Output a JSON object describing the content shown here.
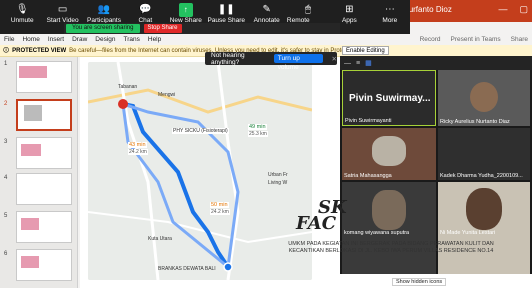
{
  "window": {
    "title": "le Kaolin Nurfanto Dioz"
  },
  "zoom_toolbar": {
    "items": [
      {
        "label": "Unmute",
        "icon": "mic-muted-icon"
      },
      {
        "label": "Start Video",
        "icon": "video-off-icon"
      },
      {
        "label": "Participants",
        "icon": "participants-icon",
        "badge": "9"
      },
      {
        "label": "Chat",
        "icon": "chat-icon"
      },
      {
        "label": "New Share",
        "icon": "share-screen-icon"
      },
      {
        "label": "Pause Share",
        "icon": "pause-icon"
      },
      {
        "label": "Annotate",
        "icon": "annotate-icon"
      },
      {
        "label": "Remote Control",
        "icon": "remote-control-icon"
      },
      {
        "label": "Apps",
        "icon": "apps-icon"
      },
      {
        "label": "More",
        "icon": "more-icon"
      }
    ],
    "share_status": "You are screen sharing",
    "stop_share": "Stop Share"
  },
  "menu": {
    "items": [
      "File",
      "Home",
      "Insert",
      "Draw",
      "Design",
      "Trans",
      "Help"
    ],
    "right": [
      "Record",
      "Present in Teams",
      "Share"
    ]
  },
  "protected_view": {
    "title": "PROTECTED VIEW",
    "message": "Be careful—files from the Internet can contain viruses. Unless you need to edit, it's safer to stay in Protected View.",
    "button": "Enable Editing"
  },
  "notification": {
    "text": "Not hearing anything?",
    "button": "Turn up volume"
  },
  "slides": [
    "1",
    "2",
    "3",
    "4",
    "5",
    "6"
  ],
  "map": {
    "labels": [
      "Tabanan",
      "Mengwi",
      "PHY SICKU (Fisioterapi)",
      "43 min",
      "24.2 km",
      "49 min",
      "25.3 km",
      "50 min",
      "24.2 km",
      "Urban Fr",
      "Living W",
      "Kuta Utara",
      "BRANKAS DEWATA BALI"
    ]
  },
  "gallery": {
    "participants": [
      {
        "name": "Pivin Suwirmayanti",
        "big": "Pivin Suwirmay..."
      },
      {
        "name": "Ricky Aurelius Nurtanto Diaz"
      },
      {
        "name": "Satria Mahasangga"
      },
      {
        "name": "Kadek Dharma Yudha_2200109..."
      },
      {
        "name": "komang wiyawana suputra"
      },
      {
        "name": "Ni Made Yunita Lestari"
      }
    ]
  },
  "slide_text": {
    "line1": "SK",
    "line2": "FAC",
    "desc": "UMKM PADA KEGIATAN INI BERGERAK PADA BIDANG PERAWATAN KULIT DAN KECANTIKAN BERLOKASI DI JL. KEBO IWA PERUM VILLAS RESIDENCE NO.14"
  },
  "taskbar": {
    "hint": "Show hidden icons"
  },
  "colors": {
    "ppt": "#c43e1c",
    "share_green": "#23c160",
    "stop_red": "#e02828",
    "zoom_blue": "#0e71eb"
  }
}
